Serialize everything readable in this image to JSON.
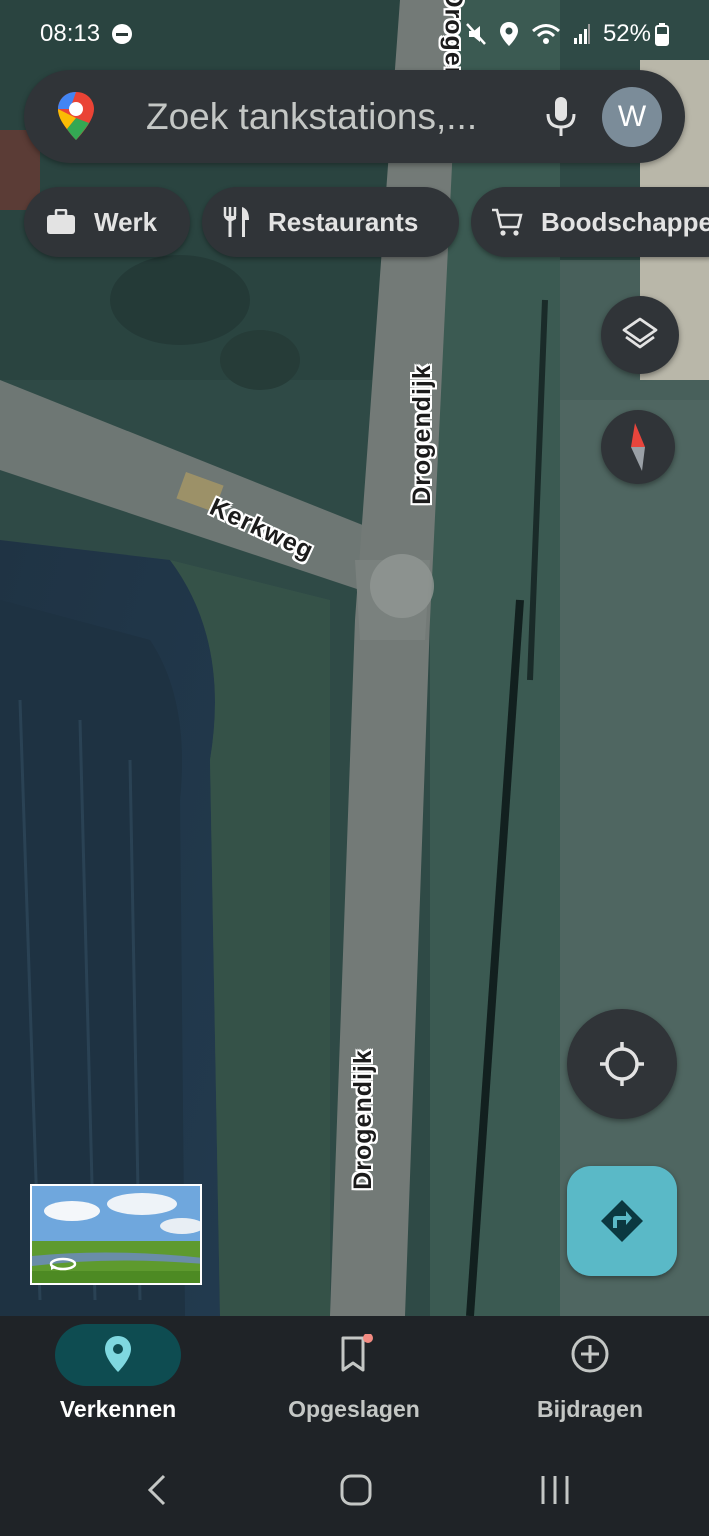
{
  "status_bar": {
    "time": "08:13",
    "battery": "52%"
  },
  "search": {
    "placeholder": "Zoek tankstations,...",
    "avatar_letter": "W"
  },
  "chips": [
    {
      "label": "Werk",
      "icon": "briefcase-icon"
    },
    {
      "label": "Restaurants",
      "icon": "fork-knife-icon"
    },
    {
      "label": "Boodschappen",
      "icon": "cart-icon"
    }
  ],
  "map": {
    "roads": [
      {
        "name": "Drogendijk"
      },
      {
        "name": "Kerkweg"
      },
      {
        "name": "Drogendijk"
      },
      {
        "name": "Drogendijk"
      }
    ]
  },
  "bottom_nav": {
    "items": [
      {
        "label": "Verkennen",
        "icon": "location-pin-icon",
        "active": true
      },
      {
        "label": "Opgeslagen",
        "icon": "bookmark-icon",
        "active": false
      },
      {
        "label": "Bijdragen",
        "icon": "add-circle-icon",
        "active": false
      }
    ]
  },
  "colors": {
    "accent_directions": "#5ab9c7",
    "active_nav_pill": "#0e4c51",
    "surface": "#303438",
    "nav_background": "#1f2327"
  }
}
